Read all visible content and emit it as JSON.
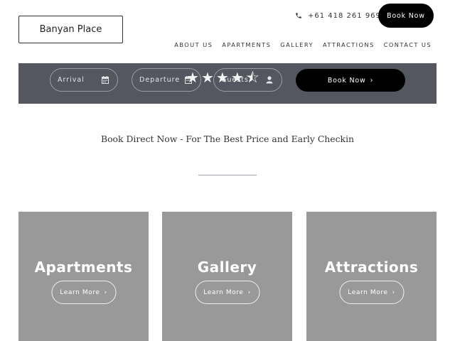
{
  "header": {
    "logo_text": "Banyan Place",
    "phone": "+61 418 261 969",
    "book_label": "Book Now"
  },
  "nav": {
    "items": [
      "ABOUT US",
      "APARTMENTS",
      "GALLERY",
      "ATTRACTIONS",
      "CONTACT US"
    ]
  },
  "booking": {
    "arrival": "Arrival",
    "departure": "Departure",
    "guests": "Guests",
    "rating": 4.5,
    "rating_max": 5,
    "book_label": "Book Now",
    "chevron": "›"
  },
  "tagline": "Book Direct Now - For The Best Price and Early Checkin",
  "cards": [
    {
      "title": "Apartments",
      "button": "Learn More",
      "chevron": "›"
    },
    {
      "title": "Gallery",
      "button": "Learn More",
      "chevron": "›"
    },
    {
      "title": "Attractions",
      "button": "Learn More",
      "chevron": "›"
    }
  ],
  "colors": {
    "booking_bar": "#545760",
    "card_bg": "#999999",
    "button_dark": "#000000"
  },
  "icons": [
    "phone-icon",
    "calendar-icon",
    "user-icon",
    "star-icon",
    "half-star-icon",
    "chevron-right-icon"
  ]
}
